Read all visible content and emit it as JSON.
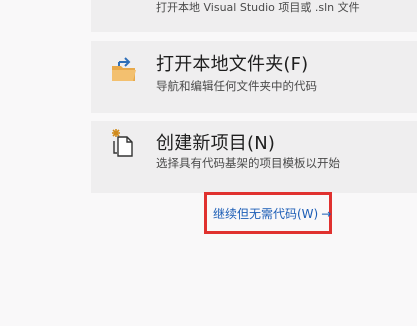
{
  "top_card": {
    "subtitle": "打开本地 Visual Studio 项目或 .sln 文件"
  },
  "open_folder": {
    "icon": "open-folder-icon",
    "title": "打开本地文件夹(F)",
    "subtitle": "导航和编辑任何文件夹中的代码"
  },
  "new_project": {
    "icon": "new-project-icon",
    "title": "创建新项目(N)",
    "subtitle": "选择具有代码基架的项目模板以开始"
  },
  "continue": {
    "label": "继续但无需代码(W)",
    "arrow": "→"
  },
  "colors": {
    "link": "#1b5db6",
    "highlight": "#e0312f",
    "folder": "#e8a94a",
    "folder_arrow": "#2f6fb8"
  }
}
